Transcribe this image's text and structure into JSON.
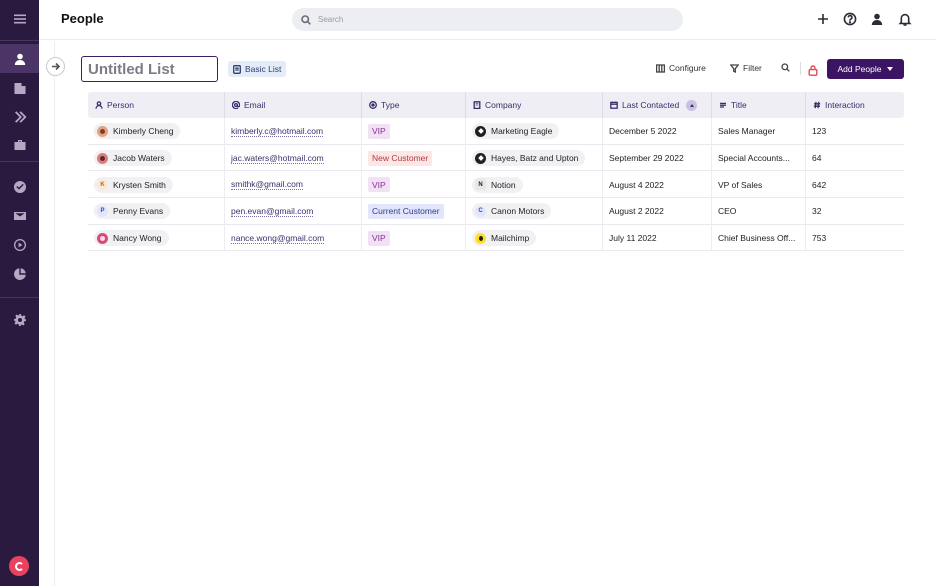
{
  "header": {
    "title": "People",
    "search_placeholder": "Search"
  },
  "toolbar": {
    "list_title": "Untitled List",
    "view_label": "Basic List",
    "configure_label": "Configure",
    "filter_label": "Filter",
    "add_label": "Add People"
  },
  "table": {
    "columns": [
      {
        "label": "Person",
        "icon": "person-icon"
      },
      {
        "label": "Email",
        "icon": "at-icon"
      },
      {
        "label": "Type",
        "icon": "circle-dot-icon"
      },
      {
        "label": "Company",
        "icon": "building-icon"
      },
      {
        "label": "Last Contacted",
        "icon": "calendar-icon"
      },
      {
        "label": "Title",
        "icon": "text-lines-icon"
      },
      {
        "label": "Interaction",
        "icon": "hash-icon"
      }
    ],
    "rows": [
      {
        "person": "Kimberly Cheng",
        "email": "kimberly.c@hotmail.com",
        "type": "VIP",
        "company": "Marketing Eagle",
        "last_contacted": "December 5 2022",
        "title": "Sales Manager",
        "interaction": "123"
      },
      {
        "person": "Jacob Waters",
        "email": "jac.waters@hotmail.com",
        "type": "New Customer",
        "company": "Hayes, Batz and Upton",
        "last_contacted": "September 29 2022",
        "title": "Special Accounts...",
        "interaction": "64"
      },
      {
        "person": "Krysten Smith",
        "avatar_letter": "K",
        "email": "smithk@gmail.com",
        "type": "VIP",
        "company": "Notion",
        "last_contacted": "August 4 2022",
        "title": "VP of Sales",
        "interaction": "642"
      },
      {
        "person": "Penny Evans",
        "avatar_letter": "P",
        "email": "pen.evan@gmail.com",
        "type": "Current Customer",
        "company": "Canon Motors",
        "company_letter": "C",
        "last_contacted": "August 2 2022",
        "title": "CEO",
        "interaction": "32"
      },
      {
        "person": "Nancy Wong",
        "email": "nance.wong@gmail.com",
        "type": "VIP",
        "company": "Mailchimp",
        "last_contacted": "July 11 2022",
        "title": "Chief Business Off...",
        "interaction": "753"
      }
    ]
  },
  "colors": {
    "sidebar": "#2b1a3f",
    "accent": "#3b1464",
    "vip_bg": "#f2e1f5",
    "new_customer_bg": "#fde6e6",
    "current_customer_bg": "#e3e6fb"
  }
}
